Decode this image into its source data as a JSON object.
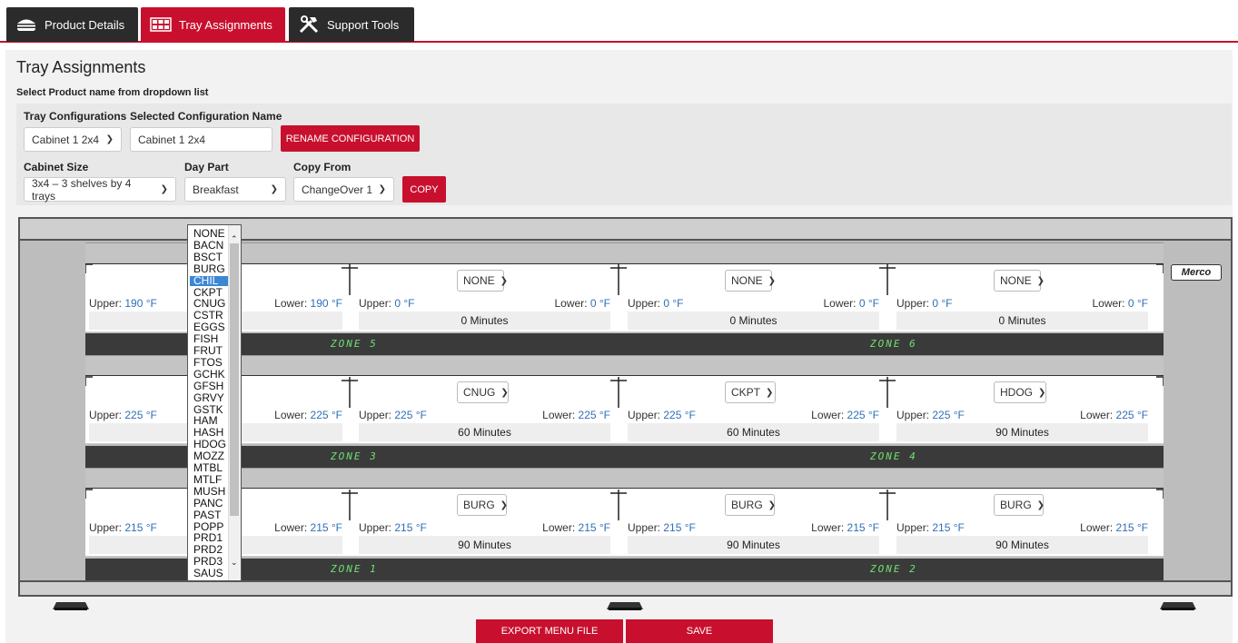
{
  "tabs": [
    {
      "label": "Product Details",
      "icon": "burger-icon"
    },
    {
      "label": "Tray Assignments",
      "icon": "tray-grid-icon",
      "active": true
    },
    {
      "label": "Support Tools",
      "icon": "tools-icon"
    }
  ],
  "page_title": "Tray Assignments",
  "subtitle": "Select Product name from dropdown list",
  "form": {
    "tray_config_label": "Tray Configurations",
    "tray_config_value": "Cabinet 1 2x4",
    "selected_name_label": "Selected Configuration Name",
    "selected_name_value": "Cabinet 1 2x4",
    "rename_button": "RENAME CONFIGURATION",
    "cabinet_size_label": "Cabinet Size",
    "cabinet_size_value": "3x4 – 3 shelves by 4 trays",
    "day_part_label": "Day Part",
    "day_part_value": "Breakfast",
    "copy_from_label": "Copy From",
    "copy_from_value": "ChangeOver 1",
    "copy_button": "COPY"
  },
  "brand": "Merco",
  "shelves": [
    {
      "zones": [
        "ZONE 5",
        "ZONE 6"
      ],
      "trays": [
        {
          "product": "",
          "upper_label": "Upper:",
          "upper": "190 °F",
          "lower_label": "Lower:",
          "lower": "190 °F",
          "minutes": ""
        },
        {
          "product": "NONE",
          "upper_label": "Upper:",
          "upper": "0 °F",
          "lower_label": "Lower:",
          "lower": "0 °F",
          "minutes": "0 Minutes"
        },
        {
          "product": "NONE",
          "upper_label": "Upper:",
          "upper": "0 °F",
          "lower_label": "Lower:",
          "lower": "0 °F",
          "minutes": "0 Minutes"
        },
        {
          "product": "NONE",
          "upper_label": "Upper:",
          "upper": "0 °F",
          "lower_label": "Lower:",
          "lower": "0 °F",
          "minutes": "0 Minutes"
        }
      ]
    },
    {
      "zones": [
        "ZONE 3",
        "ZONE 4"
      ],
      "trays": [
        {
          "product": "",
          "upper_label": "Upper:",
          "upper": "225 °F",
          "lower_label": "Lower:",
          "lower": "225 °F",
          "minutes": ""
        },
        {
          "product": "CNUG",
          "upper_label": "Upper:",
          "upper": "225 °F",
          "lower_label": "Lower:",
          "lower": "225 °F",
          "minutes": "60 Minutes"
        },
        {
          "product": "CKPT",
          "upper_label": "Upper:",
          "upper": "225 °F",
          "lower_label": "Lower:",
          "lower": "225 °F",
          "minutes": "60 Minutes"
        },
        {
          "product": "HDOG",
          "upper_label": "Upper:",
          "upper": "225 °F",
          "lower_label": "Lower:",
          "lower": "225 °F",
          "minutes": "90 Minutes"
        }
      ]
    },
    {
      "zones": [
        "ZONE 1",
        "ZONE 2"
      ],
      "trays": [
        {
          "product": "",
          "upper_label": "Upper:",
          "upper": "215 °F",
          "lower_label": "Lower:",
          "lower": "215 °F",
          "minutes": ""
        },
        {
          "product": "BURG",
          "upper_label": "Upper:",
          "upper": "215 °F",
          "lower_label": "Lower:",
          "lower": "215 °F",
          "minutes": "90 Minutes"
        },
        {
          "product": "BURG",
          "upper_label": "Upper:",
          "upper": "215 °F",
          "lower_label": "Lower:",
          "lower": "215 °F",
          "minutes": "90 Minutes"
        },
        {
          "product": "BURG",
          "upper_label": "Upper:",
          "upper": "215 °F",
          "lower_label": "Lower:",
          "lower": "215 °F",
          "minutes": "90 Minutes"
        }
      ]
    }
  ],
  "dropdown": {
    "selected": "CHIL",
    "options": [
      "NONE",
      "BACN",
      "BSCT",
      "BURG",
      "CHIL",
      "CKPT",
      "CNUG",
      "CSTR",
      "EGGS",
      "FISH",
      "FRUT",
      "FTOS",
      "GCHK",
      "GFSH",
      "GRVY",
      "GSTK",
      "HAM",
      "HASH",
      "HDOG",
      "MOZZ",
      "MTBL",
      "MTLF",
      "MUSH",
      "PANC",
      "PAST",
      "POPP",
      "PRD1",
      "PRD2",
      "PRD3",
      "SAUS"
    ]
  },
  "bottom": {
    "export_button": "EXPORT MENU FILE",
    "save_button": "SAVE"
  },
  "colors": {
    "accent": "#c8102e",
    "tab_dark": "#2b2b2b",
    "zone_text": "#6fe06f",
    "temp_value": "#2f6fb5"
  }
}
